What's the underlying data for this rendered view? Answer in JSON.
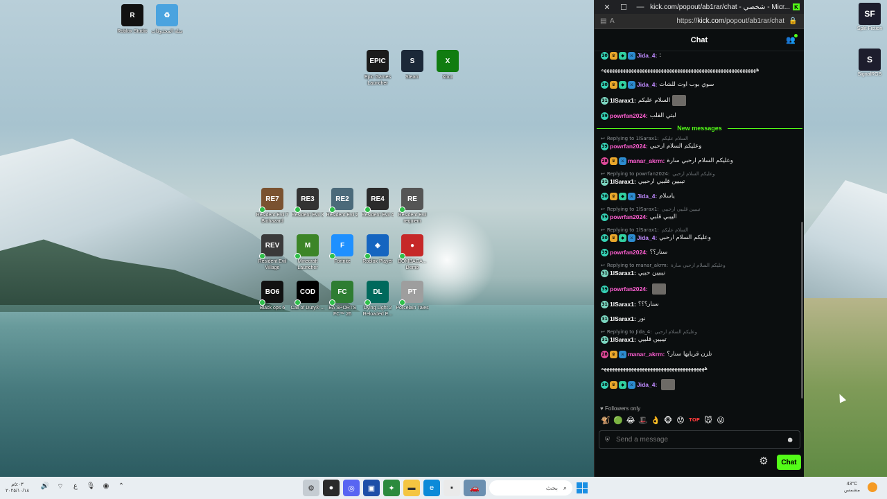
{
  "desktop": {
    "icons_left": [
      {
        "label": "Roblox Studio",
        "color": "#111111",
        "glyph": "R"
      },
      {
        "label": "سلة المحذوفات",
        "color": "#4aa3df",
        "glyph": "♻"
      },
      {
        "label": "Epic Games Launcher",
        "color": "#1b1b1b",
        "glyph": "EPIC"
      },
      {
        "label": "Steam",
        "color": "#1b2838",
        "glyph": "S"
      },
      {
        "label": "Xbox",
        "color": "#107c10",
        "glyph": "X"
      },
      {
        "label": "Resident Evil 7 Biohazard",
        "color": "#7a5230",
        "glyph": "RE7"
      },
      {
        "label": "Resident Evil 3",
        "color": "#333333",
        "glyph": "RE3"
      },
      {
        "label": "Resident Evil 2",
        "color": "#4b6a7a",
        "glyph": "RE2"
      },
      {
        "label": "Resident Evil 4",
        "color": "#2b2b2b",
        "glyph": "RE4"
      },
      {
        "label": "Resident Evil requiem",
        "color": "#555555",
        "glyph": "RE"
      },
      {
        "label": "Resident Evil Village",
        "color": "#3a3a3a",
        "glyph": "REV"
      },
      {
        "label": "Minecraft Launcher",
        "color": "#3c8527",
        "glyph": "M"
      },
      {
        "label": "Fortnite",
        "color": "#1e90ff",
        "glyph": "F"
      },
      {
        "label": "Roblox Player",
        "color": "#1565c0",
        "glyph": "◈"
      },
      {
        "label": "BOMBAGA... Demo",
        "color": "#c62828",
        "glyph": "●"
      },
      {
        "label": "Black ops 6",
        "color": "#111111",
        "glyph": "BO6"
      },
      {
        "label": "Call of Duty® ...",
        "color": "#000000",
        "glyph": "COD"
      },
      {
        "label": "EA SPORTS FC™ 26",
        "color": "#2e7d32",
        "glyph": "FC"
      },
      {
        "label": "Dying Light 2 Reloaded E...",
        "color": "#00695c",
        "glyph": "DL"
      },
      {
        "label": "Porcelain Tales",
        "color": "#9e9e9e",
        "glyph": "PT"
      }
    ],
    "icons_right": [
      {
        "label": "Split Fiction",
        "glyph": "SF"
      },
      {
        "label": "SignalRGB",
        "glyph": "S"
      }
    ]
  },
  "popup": {
    "window_title": "kick.com/popout/ab1rar/chat - شخصي - Micr...",
    "url_prefix": "https://",
    "url_domain": "kick.com",
    "url_path": "/popout/ab1rar/chat",
    "chat_title": "Chat",
    "new_messages_label": "New messages",
    "followers_only": "Followers only",
    "input_placeholder": "Send a message",
    "chat_button": "Chat"
  },
  "messages": [
    {
      "badges": [
        "sub:30",
        "og",
        "vip",
        "mod"
      ],
      "user": "Jida_4",
      "color": "#c08bff",
      "text": ":"
    },
    {
      "badges": [],
      "user": "",
      "color": "#ffffff",
      "text": "هههههههههههههههههههههههههههههههههههههههههههههههههههههههههه"
    },
    {
      "badges": [
        "sub:30",
        "og",
        "vip",
        "mod"
      ],
      "user": "Jida_4",
      "color": "#c08bff",
      "text": "سوي بوب اوت للشات"
    },
    {
      "badges": [
        "sub2:31"
      ],
      "user": "1lSarax1",
      "color": "#ffffff",
      "text": "السلام عليكم",
      "emote": true
    },
    {
      "badges": [
        "sub:39"
      ],
      "user": "powrfan2024",
      "color": "#ff5fd2",
      "text": "لبتي القلب"
    },
    {
      "divider": true
    },
    {
      "reply_to": "1lSarax1",
      "reply_text": "السلام عليكم",
      "badges": [
        "sub:39"
      ],
      "user": "powrfan2024",
      "color": "#ff5fd2",
      "text": "وعليكم السلام ارحبي"
    },
    {
      "badges": [
        "pink:28",
        "og",
        "mod"
      ],
      "user": "manar_akrm",
      "color": "#ff5fd2",
      "text": "وعليكم السلام ارحبي سارة"
    },
    {
      "reply_to": "powrfan2024",
      "reply_text": "وعليكم السلام ارحبي",
      "badges": [
        "sub2:31"
      ],
      "user": "1lSarax1",
      "color": "#ffffff",
      "text": "تيبيين قلبيي ارحبيي"
    },
    {
      "badges": [
        "sub:30",
        "og",
        "vip",
        "mod"
      ],
      "user": "Jida_4",
      "color": "#c08bff",
      "text": "ياسلام"
    },
    {
      "reply_to": "1lSarax1",
      "reply_text": "تيبيين قلبيي ارحبيي",
      "badges": [
        "sub:39"
      ],
      "user": "powrfan2024",
      "color": "#ff5fd2",
      "text": "الييبي قلبي"
    },
    {
      "reply_to": "1lSarax1",
      "reply_text": "السلام عليكم",
      "badges": [
        "sub:30",
        "og",
        "vip",
        "mod"
      ],
      "user": "Jida_4",
      "color": "#c08bff",
      "text": "وعليكم السلام ارحبي"
    },
    {
      "badges": [
        "sub:39"
      ],
      "user": "powrfan2024",
      "color": "#ff5fd2",
      "text": "سنار؟؟"
    },
    {
      "reply_to": "manar_akrm",
      "reply_text": "وعليكم السلام ارحبي سارة",
      "badges": [
        "sub2:31"
      ],
      "user": "1lSarax1",
      "color": "#ffffff",
      "text": "تيبيين حبيي"
    },
    {
      "badges": [
        "sub:39"
      ],
      "user": "powrfan2024",
      "color": "#ff5fd2",
      "text": "",
      "emote": true
    },
    {
      "badges": [
        "sub2:31"
      ],
      "user": "1lSarax1",
      "color": "#ffffff",
      "text": "سنار؟؟؟"
    },
    {
      "badges": [
        "sub2:31"
      ],
      "user": "1lSarax1",
      "color": "#ffffff",
      "text": "نور"
    },
    {
      "reply_to": "Jida_4",
      "reply_text": "وعليكم السلام ارحبي",
      "badges": [
        "sub2:31"
      ],
      "user": "1lSarax1",
      "color": "#ffffff",
      "text": "تيبيين قلبيي"
    },
    {
      "badges": [
        "pink:28",
        "og",
        "mod"
      ],
      "user": "manar_akrm",
      "color": "#ff5fd2",
      "text": "تلزن قريايها سنار؟"
    },
    {
      "badges": [],
      "user": "",
      "color": "#ffffff",
      "text": "ههههههههههههههههههههههههههههههههههههههه"
    },
    {
      "badges": [
        "sub:30",
        "og",
        "vip",
        "mod"
      ],
      "user": "Jida_4",
      "color": "#c08bff",
      "text": "",
      "emote": true
    }
  ],
  "emote_row": [
    "🐒",
    "🟢",
    "😂",
    "🎩",
    "👌",
    "🐵",
    "😟",
    "TOP",
    "🐭",
    "😜"
  ],
  "taskbar": {
    "time_left_line1": "٥:٠٣م",
    "time_left_line2": "٢٠٢٥/١٠/١٨",
    "search_placeholder": "بحث",
    "weather_temp": "43°C",
    "weather_desc": "مشمس"
  }
}
